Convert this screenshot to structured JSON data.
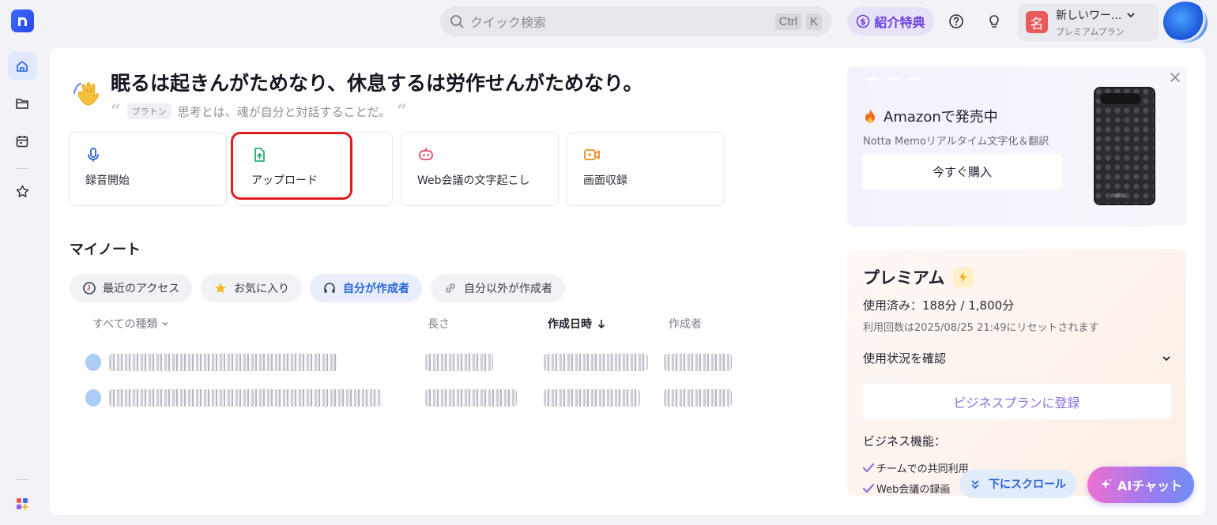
{
  "search": {
    "placeholder": "クイック検索",
    "key1": "Ctrl",
    "key2": "K"
  },
  "header": {
    "referral_label": "紹介特典",
    "workspace_avatar": "名",
    "workspace_name": "新しいワー...",
    "workspace_plan": "プレミアムプラン"
  },
  "greeting": {
    "title": "眠るは起きんがためなり、休息するは労作せんがためなり。",
    "quote_author": "プラトン",
    "quote_text": "思考とは、魂が自分と対話することだ。"
  },
  "actions": [
    {
      "label": "録音開始",
      "icon": "microphone-icon"
    },
    {
      "label": "アップロード",
      "icon": "upload-icon"
    },
    {
      "label": "Web会議の文字起こし",
      "icon": "meeting-bot-icon"
    },
    {
      "label": "画面収録",
      "icon": "screen-record-icon"
    }
  ],
  "notes": {
    "title": "マイノート",
    "filters": [
      {
        "label": "最近のアクセス",
        "icon": "clock-icon",
        "active": false
      },
      {
        "label": "お気に入り",
        "icon": "star-icon",
        "active": false
      },
      {
        "label": "自分が作成者",
        "icon": "headphones-icon",
        "active": true
      },
      {
        "label": "自分以外が作成者",
        "icon": "link-icon",
        "active": false
      }
    ],
    "columns": {
      "type": "すべての種類",
      "length": "長さ",
      "created": "作成日時",
      "creator": "作成者"
    }
  },
  "promo": {
    "title": "Amazonで発売中",
    "subtitle": "Notta Memoリアルタイム文字化＆翻訳",
    "button": "今すぐ購入",
    "device_text": "notta"
  },
  "premium": {
    "title": "プレミアム",
    "usage": "使用済み：188分 / 1,800分",
    "reset": "利用回数は2025/08/25 21:49にリセットされます",
    "check_usage": "使用状況を確認",
    "business_button": "ビジネスプランに登録",
    "business_features_title": "ビジネス機能：",
    "features": [
      "チームでの共同利用",
      "Web会議の録画"
    ]
  },
  "floating": {
    "scroll_label": "下にスクロール",
    "ai_chat_label": "AIチャット"
  },
  "colors": {
    "accent": "#2a62d8",
    "highlight": "#e01c1c",
    "referral": "#6a3fe0"
  }
}
